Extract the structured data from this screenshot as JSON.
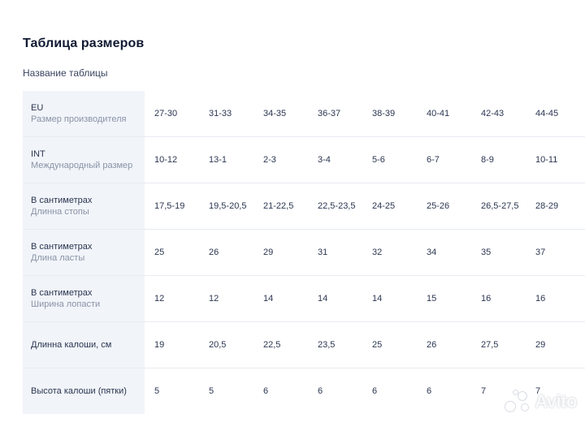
{
  "header": {
    "title": "Таблица размеров",
    "subtitle": "Название таблицы"
  },
  "table": {
    "rows": [
      {
        "label": "EU",
        "sublabel": "Размер производителя",
        "values": [
          "27-30",
          "31-33",
          "34-35",
          "36-37",
          "38-39",
          "40-41",
          "42-43",
          "44-45"
        ]
      },
      {
        "label": "INT",
        "sublabel": "Международный размер",
        "values": [
          "10-12",
          "13-1",
          "2-3",
          "3-4",
          "5-6",
          "6-7",
          "8-9",
          "10-11"
        ]
      },
      {
        "label": "В сантиметрах",
        "sublabel": "Длинна стопы",
        "values": [
          "17,5-19",
          "19,5-20,5",
          "21-22,5",
          "22,5-23,5",
          "24-25",
          "25-26",
          "26,5-27,5",
          "28-29"
        ]
      },
      {
        "label": "В сантиметрах",
        "sublabel": "Длина ласты",
        "values": [
          "25",
          "26",
          "29",
          "31",
          "32",
          "34",
          "35",
          "37"
        ]
      },
      {
        "label": "В сантиметрах",
        "sublabel": "Ширина лопасти",
        "values": [
          "12",
          "12",
          "14",
          "14",
          "14",
          "15",
          "16",
          "16"
        ]
      },
      {
        "label": "Длинна калоши, см",
        "sublabel": "",
        "values": [
          "19",
          "20,5",
          "22,5",
          "23,5",
          "25",
          "26",
          "27,5",
          "29"
        ]
      },
      {
        "label": "Высота калоши (пятки)",
        "sublabel": "",
        "values": [
          "5",
          "5",
          "6",
          "6",
          "6",
          "6",
          "7",
          "7"
        ]
      }
    ]
  },
  "watermark": {
    "text": "Avito"
  },
  "colors": {
    "label_column_bg": "#f1f4f9",
    "title": "#111a33",
    "text": "#2a3550",
    "sublabel": "#8a93a6"
  }
}
